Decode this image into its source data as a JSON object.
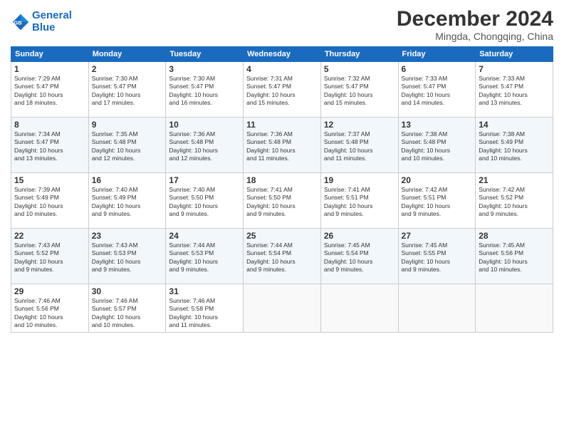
{
  "header": {
    "logo_line1": "General",
    "logo_line2": "Blue",
    "month_year": "December 2024",
    "location": "Mingda, Chongqing, China"
  },
  "days_of_week": [
    "Sunday",
    "Monday",
    "Tuesday",
    "Wednesday",
    "Thursday",
    "Friday",
    "Saturday"
  ],
  "weeks": [
    [
      {
        "day": "1",
        "info": "Sunrise: 7:29 AM\nSunset: 5:47 PM\nDaylight: 10 hours\nand 18 minutes."
      },
      {
        "day": "2",
        "info": "Sunrise: 7:30 AM\nSunset: 5:47 PM\nDaylight: 10 hours\nand 17 minutes."
      },
      {
        "day": "3",
        "info": "Sunrise: 7:30 AM\nSunset: 5:47 PM\nDaylight: 10 hours\nand 16 minutes."
      },
      {
        "day": "4",
        "info": "Sunrise: 7:31 AM\nSunset: 5:47 PM\nDaylight: 10 hours\nand 15 minutes."
      },
      {
        "day": "5",
        "info": "Sunrise: 7:32 AM\nSunset: 5:47 PM\nDaylight: 10 hours\nand 15 minutes."
      },
      {
        "day": "6",
        "info": "Sunrise: 7:33 AM\nSunset: 5:47 PM\nDaylight: 10 hours\nand 14 minutes."
      },
      {
        "day": "7",
        "info": "Sunrise: 7:33 AM\nSunset: 5:47 PM\nDaylight: 10 hours\nand 13 minutes."
      }
    ],
    [
      {
        "day": "8",
        "info": "Sunrise: 7:34 AM\nSunset: 5:47 PM\nDaylight: 10 hours\nand 13 minutes."
      },
      {
        "day": "9",
        "info": "Sunrise: 7:35 AM\nSunset: 5:48 PM\nDaylight: 10 hours\nand 12 minutes."
      },
      {
        "day": "10",
        "info": "Sunrise: 7:36 AM\nSunset: 5:48 PM\nDaylight: 10 hours\nand 12 minutes."
      },
      {
        "day": "11",
        "info": "Sunrise: 7:36 AM\nSunset: 5:48 PM\nDaylight: 10 hours\nand 11 minutes."
      },
      {
        "day": "12",
        "info": "Sunrise: 7:37 AM\nSunset: 5:48 PM\nDaylight: 10 hours\nand 11 minutes."
      },
      {
        "day": "13",
        "info": "Sunrise: 7:38 AM\nSunset: 5:48 PM\nDaylight: 10 hours\nand 10 minutes."
      },
      {
        "day": "14",
        "info": "Sunrise: 7:38 AM\nSunset: 5:49 PM\nDaylight: 10 hours\nand 10 minutes."
      }
    ],
    [
      {
        "day": "15",
        "info": "Sunrise: 7:39 AM\nSunset: 5:49 PM\nDaylight: 10 hours\nand 10 minutes."
      },
      {
        "day": "16",
        "info": "Sunrise: 7:40 AM\nSunset: 5:49 PM\nDaylight: 10 hours\nand 9 minutes."
      },
      {
        "day": "17",
        "info": "Sunrise: 7:40 AM\nSunset: 5:50 PM\nDaylight: 10 hours\nand 9 minutes."
      },
      {
        "day": "18",
        "info": "Sunrise: 7:41 AM\nSunset: 5:50 PM\nDaylight: 10 hours\nand 9 minutes."
      },
      {
        "day": "19",
        "info": "Sunrise: 7:41 AM\nSunset: 5:51 PM\nDaylight: 10 hours\nand 9 minutes."
      },
      {
        "day": "20",
        "info": "Sunrise: 7:42 AM\nSunset: 5:51 PM\nDaylight: 10 hours\nand 9 minutes."
      },
      {
        "day": "21",
        "info": "Sunrise: 7:42 AM\nSunset: 5:52 PM\nDaylight: 10 hours\nand 9 minutes."
      }
    ],
    [
      {
        "day": "22",
        "info": "Sunrise: 7:43 AM\nSunset: 5:52 PM\nDaylight: 10 hours\nand 9 minutes."
      },
      {
        "day": "23",
        "info": "Sunrise: 7:43 AM\nSunset: 5:53 PM\nDaylight: 10 hours\nand 9 minutes."
      },
      {
        "day": "24",
        "info": "Sunrise: 7:44 AM\nSunset: 5:53 PM\nDaylight: 10 hours\nand 9 minutes."
      },
      {
        "day": "25",
        "info": "Sunrise: 7:44 AM\nSunset: 5:54 PM\nDaylight: 10 hours\nand 9 minutes."
      },
      {
        "day": "26",
        "info": "Sunrise: 7:45 AM\nSunset: 5:54 PM\nDaylight: 10 hours\nand 9 minutes."
      },
      {
        "day": "27",
        "info": "Sunrise: 7:45 AM\nSunset: 5:55 PM\nDaylight: 10 hours\nand 9 minutes."
      },
      {
        "day": "28",
        "info": "Sunrise: 7:45 AM\nSunset: 5:56 PM\nDaylight: 10 hours\nand 10 minutes."
      }
    ],
    [
      {
        "day": "29",
        "info": "Sunrise: 7:46 AM\nSunset: 5:56 PM\nDaylight: 10 hours\nand 10 minutes."
      },
      {
        "day": "30",
        "info": "Sunrise: 7:46 AM\nSunset: 5:57 PM\nDaylight: 10 hours\nand 10 minutes."
      },
      {
        "day": "31",
        "info": "Sunrise: 7:46 AM\nSunset: 5:58 PM\nDaylight: 10 hours\nand 11 minutes."
      },
      {
        "day": "",
        "info": ""
      },
      {
        "day": "",
        "info": ""
      },
      {
        "day": "",
        "info": ""
      },
      {
        "day": "",
        "info": ""
      }
    ]
  ]
}
